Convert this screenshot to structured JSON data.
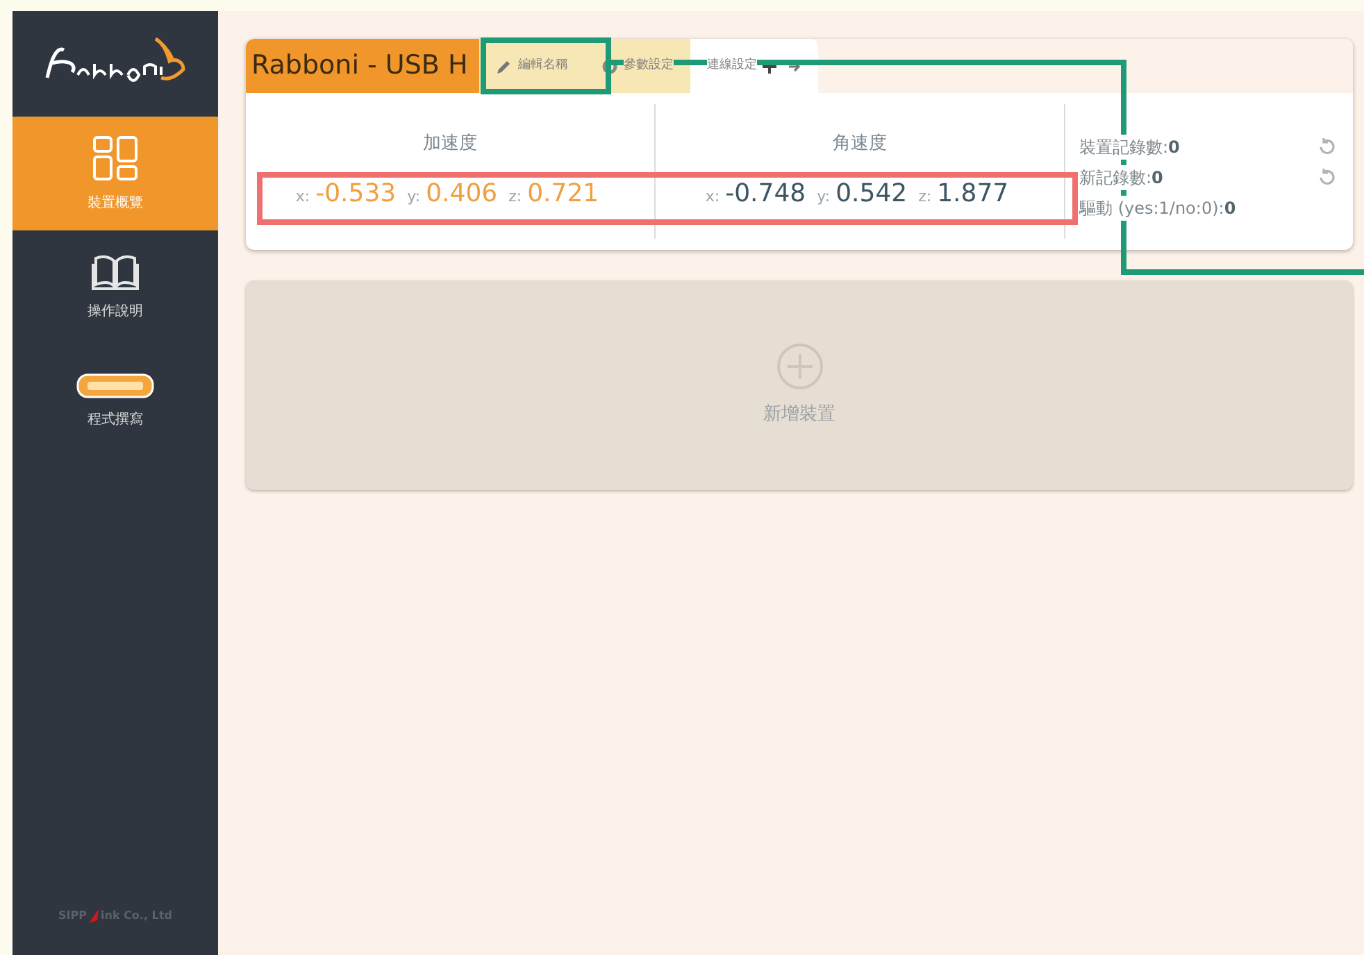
{
  "sidebar": {
    "items": [
      {
        "label": "裝置概覽",
        "selected": true
      },
      {
        "label": "操作說明",
        "selected": false
      },
      {
        "label": "程式撰寫",
        "selected": false
      }
    ],
    "footer": {
      "before": "SIPP",
      "after": "ink Co., Ltd"
    }
  },
  "device_card": {
    "title": "Rabboni - USB H",
    "tabs": [
      {
        "kind": "edit",
        "label": "編輯名稱",
        "selected": false
      },
      {
        "kind": "settings",
        "label": "參數設定",
        "selected": false
      },
      {
        "kind": "connect",
        "label": "連線設定",
        "selected": true
      }
    ],
    "sensors": [
      {
        "heading": "加速度",
        "color": "#f0a040",
        "axes": [
          {
            "label": "x:",
            "value": "-0.533"
          },
          {
            "label": "y:",
            "value": "0.406"
          },
          {
            "label": "z:",
            "value": "0.721"
          }
        ]
      },
      {
        "heading": "角速度",
        "color": "#3e5563",
        "axes": [
          {
            "label": "x:",
            "value": "-0.748"
          },
          {
            "label": "y:",
            "value": "0.542"
          },
          {
            "label": "z:",
            "value": "1.877"
          }
        ]
      }
    ],
    "stats": [
      {
        "label": "裝置記錄數:",
        "value": "0",
        "resettable": true
      },
      {
        "label": "新記錄數:",
        "value": "0",
        "resettable": true
      },
      {
        "label": "驅動 (yes:1/no:0):",
        "value": "0",
        "resettable": false
      }
    ]
  },
  "add_device": {
    "label": "新增裝置"
  },
  "annotations": [
    {
      "kind": "box",
      "color": "#1e9a76"
    },
    {
      "kind": "callout",
      "color": "#1e9a76"
    },
    {
      "kind": "box",
      "color": "#f07070"
    }
  ]
}
